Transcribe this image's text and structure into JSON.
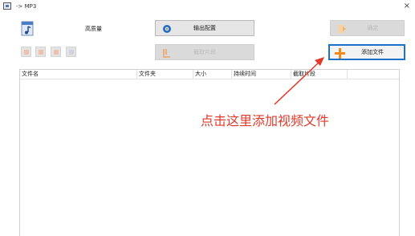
{
  "window": {
    "title": "-> MP3",
    "close_symbol": "×"
  },
  "toolbar": {
    "quality_label": "高质量",
    "output_config_label": "输出配置",
    "confirm_label": "确定",
    "trim_label": "截取片段",
    "add_file_label": "添加文件"
  },
  "table": {
    "columns": [
      "文件名",
      "文件夹",
      "大小",
      "持续时间",
      "截取片段"
    ],
    "rows": []
  },
  "annotation": {
    "text": "点击这里添加视频文件",
    "color": "#e23a2a"
  },
  "colors": {
    "highlight_border": "#1e70c8",
    "add_icon": "#f08a1c",
    "accent_blue": "#1a5fa8"
  }
}
